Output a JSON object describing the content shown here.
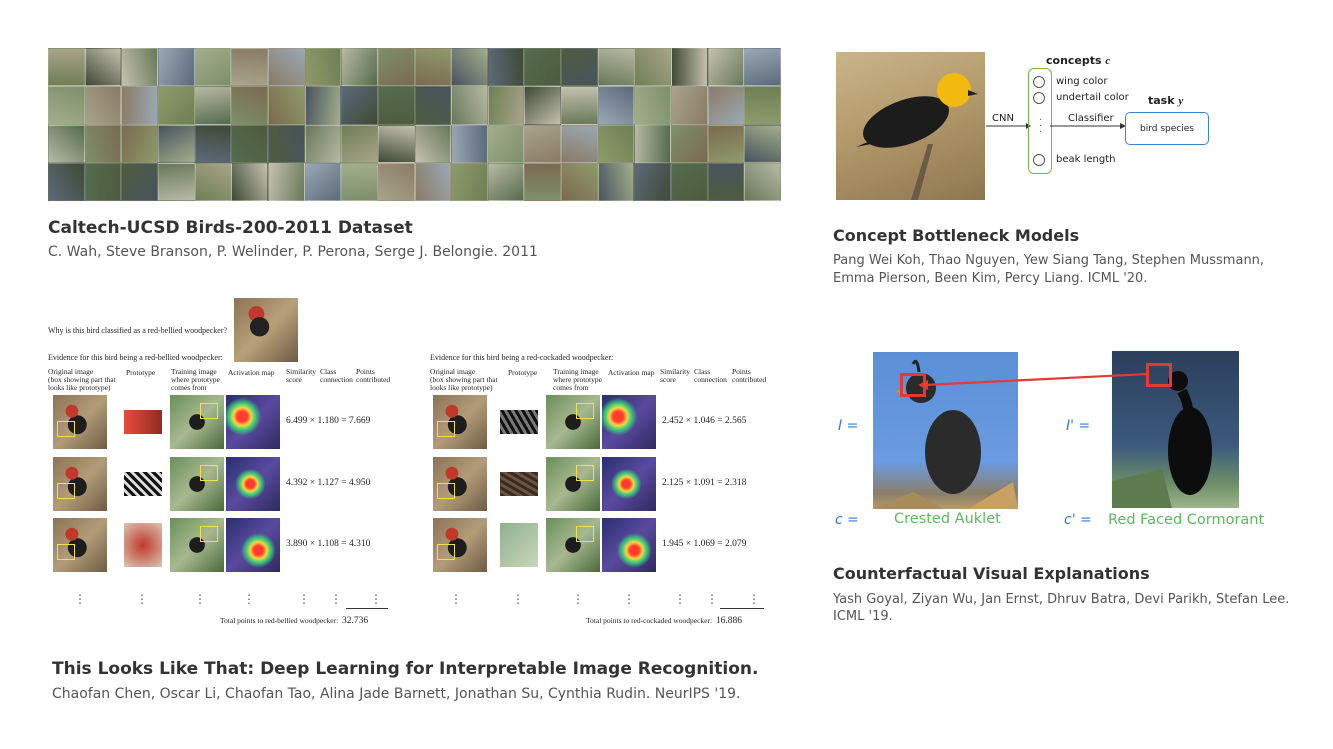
{
  "papers": {
    "cub": {
      "title": "Caltech-UCSD Birds-200-2011 Dataset",
      "authors": "C. Wah, Steve Branson, P. Welinder, P. Perona, Serge J. Belongie. 2011"
    },
    "cbm": {
      "title": "Concept Bottleneck Models",
      "authors_line1": "Pang Wei Koh, Thao Nguyen, Yew Siang Tang, Stephen Mussmann,",
      "authors_line2": "Emma Pierson, Been Kim, Percy Liang. ICML '20."
    },
    "proto": {
      "title": "This Looks Like That: Deep Learning for Interpretable Image Recognition.",
      "authors": "Chaofan Chen, Oscar Li, Chaofan Tao, Alina Jade Barnett, Jonathan Su, Cynthia Rudin. NeurIPS '19."
    },
    "cve": {
      "title": "Counterfactual Visual Explanations",
      "authors_line1": "Yash Goyal, Ziyan Wu, Jan Ernst, Dhruv Batra, Devi Parikh, Stefan Lee.",
      "authors_line2": "ICML '19."
    }
  },
  "cbm_diagram": {
    "concepts_label": "concepts",
    "concepts_var": "c",
    "task_label": "task",
    "task_var": "y",
    "cnn_label": "CNN",
    "classifier_label": "Classifier",
    "concept_items": [
      "wing color",
      "undertail color",
      "beak length"
    ],
    "output_label": "bird species"
  },
  "protopnet": {
    "question": "Why is this bird classified as a red-bellied woodpecker?",
    "evidence_left": "Evidence for this bird being a red-bellied woodpecker:",
    "evidence_right": "Evidence for this bird being a red-cockaded woodpecker:",
    "col_original": "Original image",
    "col_original_sub1": "(box showing part that",
    "col_original_sub2": "looks like prototype)",
    "col_prototype": "Prototype",
    "col_training": "Training image",
    "col_training_sub1": "where prototype",
    "col_training_sub2": "comes from",
    "col_activation": "Activation map",
    "col_similarity": "Similarity",
    "col_similarity_sub": "score",
    "col_class": "Class",
    "col_class_sub": "connection",
    "col_points": "Points",
    "col_points_sub": "contributed",
    "rows_left": [
      "6.499 × 1.180 = 7.669",
      "4.392 × 1.127 = 4.950",
      "3.890 × 1.108 = 4.310"
    ],
    "rows_right": [
      "2.452 × 1.046 = 2.565",
      "2.125 × 1.091 = 2.318",
      "1.945 × 1.069 = 2.079"
    ],
    "total_left_label": "Total points to red-bellied woodpecker:",
    "total_left_value": "32.736",
    "total_right_label": "Total points to red-cockaded woodpecker:",
    "total_right_value": "16.886"
  },
  "cve_diagram": {
    "i_label": "I =",
    "i_prime_label": "I' =",
    "c_label": "c =",
    "c_prime_label": "c' =",
    "class_left": "Crested Auklet",
    "class_right": "Red Faced Cormorant",
    "highlight_color": "#e53935",
    "class_color": "#5cb85c",
    "label_color": "#3a78c9"
  }
}
